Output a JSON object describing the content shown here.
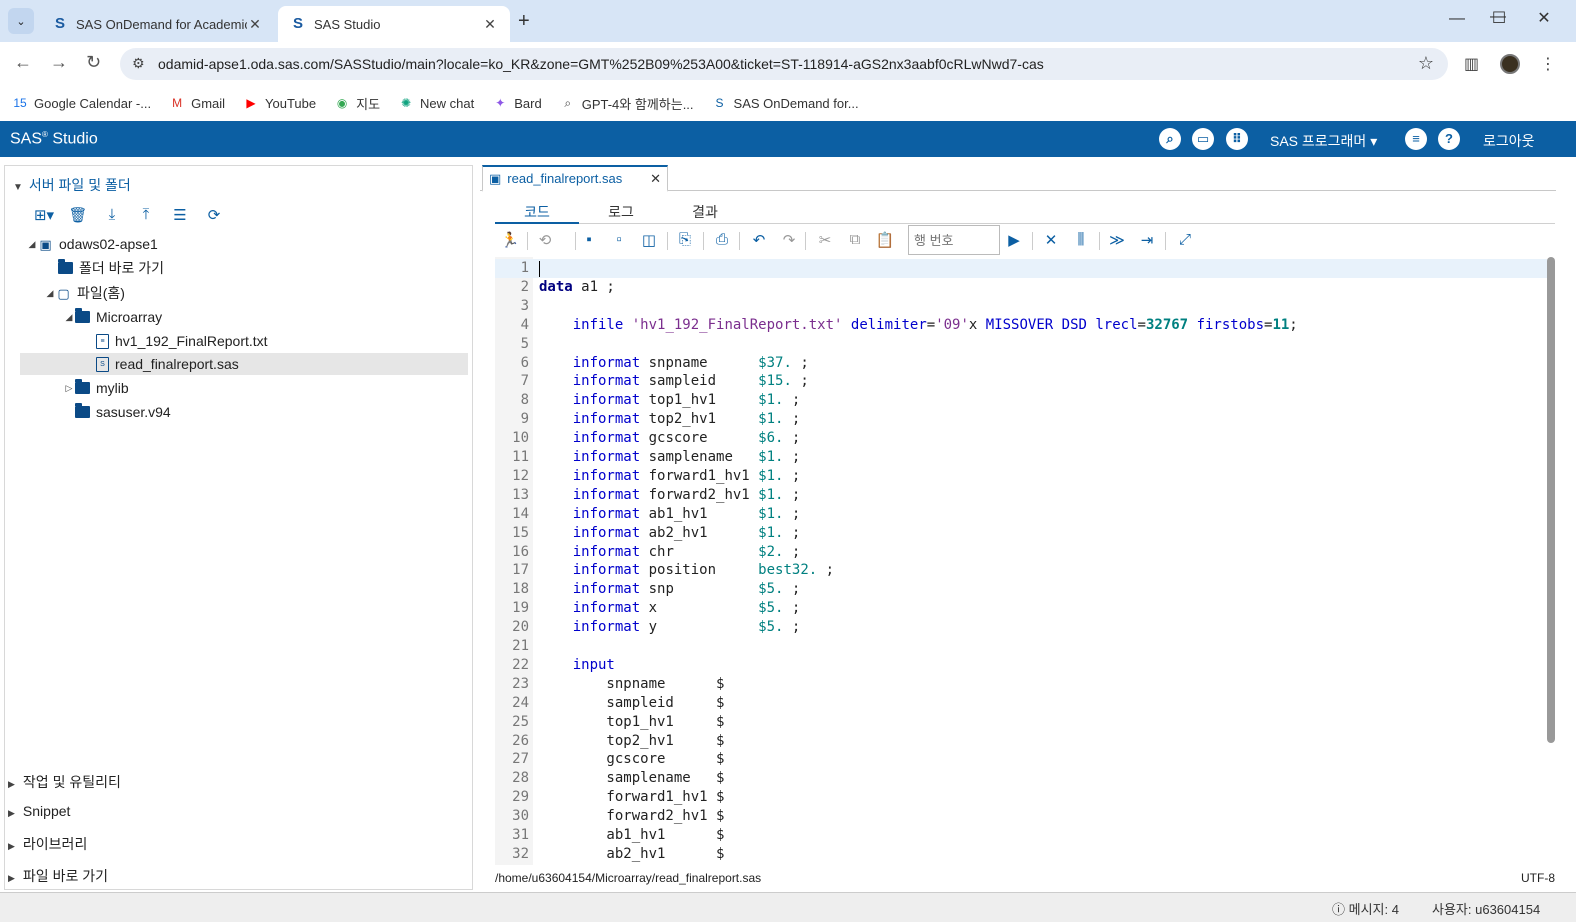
{
  "browser": {
    "tabs": [
      {
        "title": "SAS OnDemand for Academic",
        "close": "✕"
      },
      {
        "title": "SAS Studio",
        "close": "✕"
      }
    ],
    "new_tab": "+",
    "url": "odamid-apse1.oda.sas.com/SASStudio/main?locale=ko_KR&zone=GMT%252B09%253A00&ticket=ST-118914-aGS2nx3aabf0cRLwNwd7-cas",
    "bookmarks": [
      {
        "label": "Google Calendar -...",
        "icon": "calendar-icon",
        "color": "#1a73e8"
      },
      {
        "label": "Gmail",
        "icon": "gmail-icon",
        "color": "#d93025"
      },
      {
        "label": "YouTube",
        "icon": "youtube-icon",
        "color": "#ff0000"
      },
      {
        "label": "지도",
        "icon": "maps-icon",
        "color": "#34a853"
      },
      {
        "label": "New chat",
        "icon": "chatgpt-icon",
        "color": "#10a37f"
      },
      {
        "label": "Bard",
        "icon": "bard-icon",
        "color": "#8e57e6"
      },
      {
        "label": "GPT-4와 함께하는...",
        "icon": "search-icon",
        "color": "#444444"
      },
      {
        "label": "SAS OnDemand for...",
        "icon": "sas-icon",
        "color": "#0c5fa3"
      }
    ]
  },
  "sas": {
    "brand": "SAS",
    "brand_sup": "®",
    "brand_suffix": " Studio",
    "perspective": "SAS 프로그래머 ▾",
    "logout": "로그아웃"
  },
  "left": {
    "title": "서버 파일 및 폴더",
    "tree": [
      {
        "label": "odaws02-apse1",
        "type": "server"
      },
      {
        "label": "폴더 바로 가기",
        "type": "shortcut"
      },
      {
        "label": "파일(홈)",
        "type": "home"
      },
      {
        "label": "Microarray",
        "type": "folder"
      },
      {
        "label": "hv1_192_FinalReport.txt",
        "type": "file"
      },
      {
        "label": "read_finalreport.sas",
        "type": "sasfile"
      },
      {
        "label": "mylib",
        "type": "folder"
      },
      {
        "label": "sasuser.v94",
        "type": "folder"
      }
    ],
    "sections": [
      "작업 및 유틸리티",
      "Snippet",
      "라이브러리",
      "파일 바로 가기"
    ]
  },
  "editor": {
    "tab_label": "read_finalreport.sas",
    "subtabs": [
      "코드",
      "로그",
      "결과"
    ],
    "line_placeholder": "행 번호",
    "lines": [
      "",
      "data a1 ;",
      "",
      "    infile 'hv1_192_FinalReport.txt' delimiter='09'x MISSOVER DSD lrecl=32767 firstobs=11;",
      "",
      "    informat snpname      $37. ;",
      "    informat sampleid     $15. ;",
      "    informat top1_hv1     $1. ;",
      "    informat top2_hv1     $1. ;",
      "    informat gcscore      $6. ;",
      "    informat samplename   $1. ;",
      "    informat forward1_hv1 $1. ;",
      "    informat forward2_hv1 $1. ;",
      "    informat ab1_hv1      $1. ;",
      "    informat ab2_hv1      $1. ;",
      "    informat chr          $2. ;",
      "    informat position     best32. ;",
      "    informat snp          $5. ;",
      "    informat x            $5. ;",
      "    informat y            $5. ;",
      "",
      "    input",
      "        snpname      $",
      "        sampleid     $",
      "        top1_hv1     $",
      "        top2_hv1     $",
      "        gcscore      $",
      "        samplename   $",
      "        forward1_hv1 $",
      "        forward2_hv1 $",
      "        ab1_hv1      $",
      "        ab2_hv1      $"
    ],
    "path": "/home/u63604154/Microarray/read_finalreport.sas",
    "encoding": "UTF-8"
  },
  "status": {
    "messages": "메시지: 4",
    "user": "사용자: u63604154"
  }
}
